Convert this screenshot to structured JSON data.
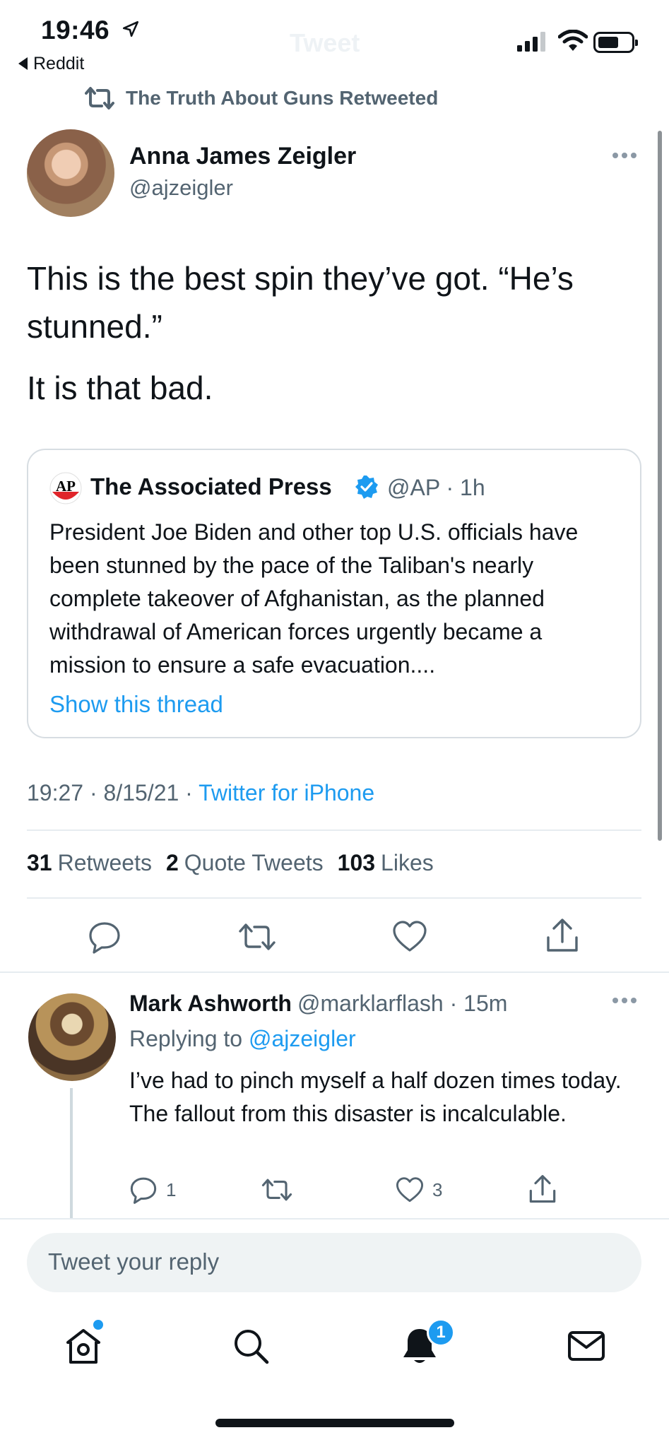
{
  "status_bar": {
    "time": "19:46",
    "back_app": "Reddit",
    "faded_title": "Tweet"
  },
  "retweet_context": "The Truth About Guns Retweeted",
  "main_tweet": {
    "author_name": "Anna James Zeigler",
    "author_handle": "@ajzeigler",
    "text_line1": "This is the best spin they’ve got. “He’s stunned.”",
    "text_line2": "It is that bad.",
    "timestamp": "19:27 · 8/15/21 · ",
    "source": "Twitter for iPhone",
    "stats": {
      "retweets_count": "31",
      "retweets_label": "Retweets",
      "quotes_count": "2",
      "quotes_label": "Quote Tweets",
      "likes_count": "103",
      "likes_label": "Likes"
    }
  },
  "quoted_tweet": {
    "logo_text": "AP",
    "author_name": "The Associated Press",
    "meta": "@AP · 1h",
    "text": "President Joe Biden and other top U.S. officials have been stunned by the pace of the Taliban's nearly complete takeover of Afghanistan, as the planned withdrawal of American forces urgently became a mission to ensure a safe evacuation....",
    "show_thread": "Show this thread"
  },
  "reply": {
    "author_name": "Mark Ashworth",
    "meta": "@marklarflash · 15m",
    "replying_prefix": "Replying to ",
    "replying_to": "@ajzeigler",
    "text": "I’ve had to pinch myself a half dozen times today. The fallout from this disaster is incalculable.",
    "reply_count": "1",
    "like_count": "3"
  },
  "compose": {
    "placeholder": "Tweet your reply"
  },
  "tab_bar": {
    "notifications_badge": "1"
  },
  "colors": {
    "accent": "#1d9bf0",
    "secondary_text": "#536471",
    "divider": "#e6ecf0"
  }
}
